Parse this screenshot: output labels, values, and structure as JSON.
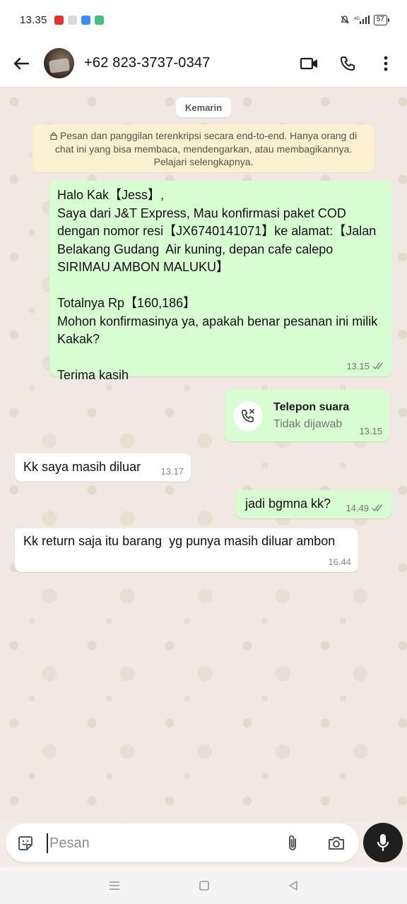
{
  "status_bar": {
    "time": "13.35",
    "battery": "57"
  },
  "header": {
    "contact": "+62 823-3737-0347"
  },
  "chat": {
    "date_chip": "Kemarin",
    "encryption_notice": "Pesan dan panggilan terenkripsi secara end-to-end. Hanya orang di chat ini yang bisa membaca, mendengarkan, atau membagikannya. Pelajari selengkapnya.",
    "messages": [
      {
        "text": "Halo Kak【Jess】,\nSaya dari J&T Express, Mau konfirmasi paket COD dengan nomor resi【JX6740141071】ke alamat:【Jalan Belakang Gudang  Air kuning, depan cafe calepo SIRIMAU AMBON MALUKU】\n\nTotalnya Rp【160,186】\nMohon konfirmasinya ya, apakah benar pesanan ini milik Kakak?\n\nTerima kasih",
        "time": "13.15"
      },
      {
        "call_title": "Telepon suara",
        "call_status": "Tidak dijawab",
        "time": "13.15"
      },
      {
        "text": "Kk saya masih diluar",
        "time": "13.17"
      },
      {
        "text": "jadi bgmna kk?",
        "time": "14.49"
      },
      {
        "text": "Kk return saja itu barang  yg punya masih diluar ambon",
        "time": "16.44"
      }
    ]
  },
  "composer": {
    "placeholder": "Pesan"
  },
  "colors": {
    "outgoing": "#d8fdd2",
    "incoming": "#ffffff",
    "notice": "#fbf0cf"
  }
}
